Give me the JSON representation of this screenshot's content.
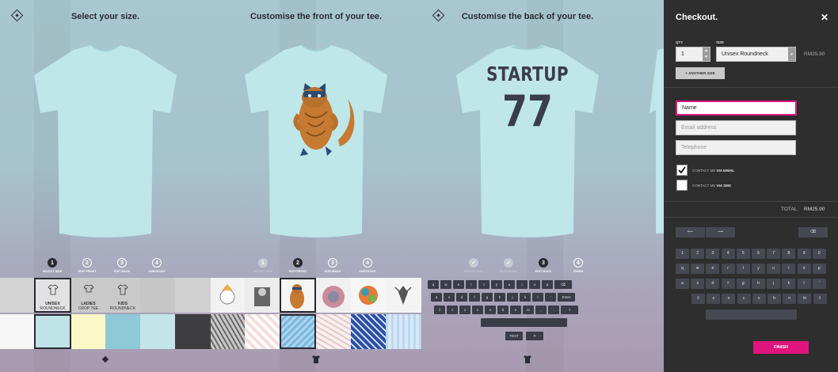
{
  "panel1": {
    "title": "Select your size.",
    "steps": [
      {
        "num": "1",
        "label": "SELECT SIZE",
        "state": "active"
      },
      {
        "num": "2",
        "label": "EDIT FRONT",
        "state": "todo"
      },
      {
        "num": "3",
        "label": "EDIT BACK",
        "state": "todo"
      },
      {
        "num": "4",
        "label": "CHECKOUT",
        "state": "todo"
      }
    ],
    "sizes": [
      {
        "name": "UNISEX",
        "sub": "ROUNDNECK"
      },
      {
        "name": "LADIES",
        "sub": "CROP TEE"
      },
      {
        "name": "KIDS",
        "sub": "ROUNDNECK"
      }
    ],
    "colors": [
      "#f6f6f6",
      "#bfe3e6",
      "#fbf7c6",
      "#8fc8d6",
      "#c3e4e8",
      "#3e3e40"
    ]
  },
  "panel2": {
    "title": "Customise the front of your tee.",
    "steps": [
      {
        "num": "1",
        "label": "SELECT SIZE",
        "state": "done"
      },
      {
        "num": "2",
        "label": "EDIT FRONT",
        "state": "active"
      },
      {
        "num": "3",
        "label": "EDIT BACK",
        "state": "todo"
      },
      {
        "num": "4",
        "label": "CHECKOUT",
        "state": "todo"
      }
    ]
  },
  "panel3": {
    "title": "Customise the back of your tee.",
    "print_name": "STARTUP",
    "print_number": "77",
    "steps": [
      {
        "num": "1",
        "label": "SELECT SIZE",
        "state": "done"
      },
      {
        "num": "2",
        "label": "EDIT FRONT",
        "state": "done"
      },
      {
        "num": "3",
        "label": "EDIT BACK",
        "state": "active"
      },
      {
        "num": "4",
        "label": "FINISH",
        "state": "todo"
      }
    ],
    "keyboard": {
      "row1": [
        "q",
        "w",
        "e",
        "r",
        "t",
        "y",
        "u",
        "i",
        "o",
        "p",
        "⌫"
      ],
      "row2": [
        "a",
        "s",
        "d",
        "f",
        "g",
        "h",
        "j",
        "k",
        "l",
        "'",
        "Enter"
      ],
      "row3": [
        "⇧",
        "z",
        "x",
        "c",
        "v",
        "b",
        "n",
        "m",
        ",",
        ".",
        "?"
      ],
      "mode_text": "TEXT",
      "mode_number": "#"
    }
  },
  "checkout": {
    "title": "Checkout.",
    "close": "✕",
    "qty_label": "QTY",
    "size_label": "SIZE",
    "qty_value": "1",
    "size_value": "Unisex Roundneck",
    "line_price": "RM25.90",
    "another_size": "+ ANOTHER SIZE",
    "name_value": "Name",
    "email_placeholder": "Email address",
    "phone_placeholder": "Telephone",
    "contact_email_prefix": "CONTACT ME ",
    "contact_email_strong": "VIA EMAIL",
    "contact_sms_prefix": "CONTACT ME ",
    "contact_sms_strong": "VIA SMS",
    "total_label": "TOTAL",
    "total_value": "RM25.90",
    "kb_row1": [
      "1",
      "2",
      "3",
      "4",
      "5",
      "6",
      "7",
      "8",
      "9",
      "0"
    ],
    "kb_row2": [
      "q",
      "w",
      "e",
      "r",
      "t",
      "y",
      "u",
      "i",
      "o",
      "p"
    ],
    "kb_row3": [
      "a",
      "s",
      "d",
      "f",
      "g",
      "h",
      "j",
      "k",
      "l",
      "'"
    ],
    "kb_row4": [
      "⇧",
      "z",
      "x",
      "c",
      "v",
      "b",
      "n",
      "m",
      "⇧"
    ],
    "finish": "FINISH"
  },
  "colors": {
    "accent": "#e0147d",
    "ink": "#2a2a34",
    "tee": "#bfe6e8"
  }
}
